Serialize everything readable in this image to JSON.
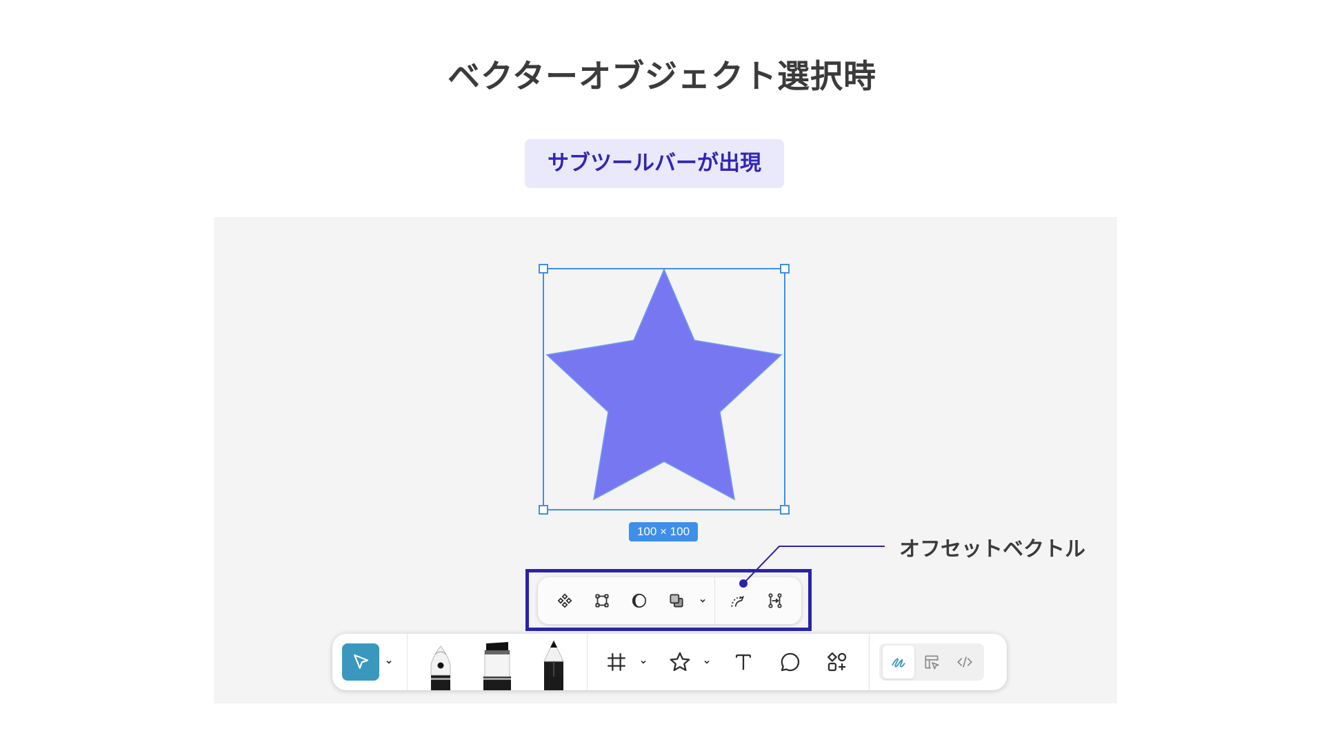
{
  "heading": "ベクターオブジェクト選択時",
  "badge": "サブツールバーが出現",
  "selection": {
    "dimensions": "100 × 100"
  },
  "callout": {
    "label": "オフセットベクトル"
  },
  "colors": {
    "star_fill": "#7877f2",
    "selection": "#3d8fe9",
    "highlight_border": "#2a23a8",
    "select_tool_active": "#3a98bf",
    "badge_bg": "#e9e9fb",
    "badge_text": "#3125b8"
  },
  "sub_toolbar": {
    "items": [
      {
        "icon": "component-icon"
      },
      {
        "icon": "frame-selection-icon"
      },
      {
        "icon": "mask-icon"
      },
      {
        "icon": "boolean-union-icon",
        "has_dropdown": true
      },
      {
        "icon": "offset-path-icon"
      },
      {
        "icon": "vector-network-icon"
      }
    ]
  },
  "main_toolbar": {
    "select_tool": {
      "icon": "move-arrow-icon",
      "active": true
    },
    "drawing_tools": [
      "pen-icon",
      "marker-icon",
      "pencil-icon"
    ],
    "shape_tools": [
      "frame-hash-icon",
      "star-shape-icon",
      "text-icon",
      "comment-bubble-icon",
      "actions-icon"
    ],
    "modes": [
      {
        "icon": "draw-mode-icon",
        "active": true
      },
      {
        "icon": "design-mode-icon",
        "active": false
      },
      {
        "icon": "dev-mode-icon",
        "active": false
      }
    ]
  }
}
